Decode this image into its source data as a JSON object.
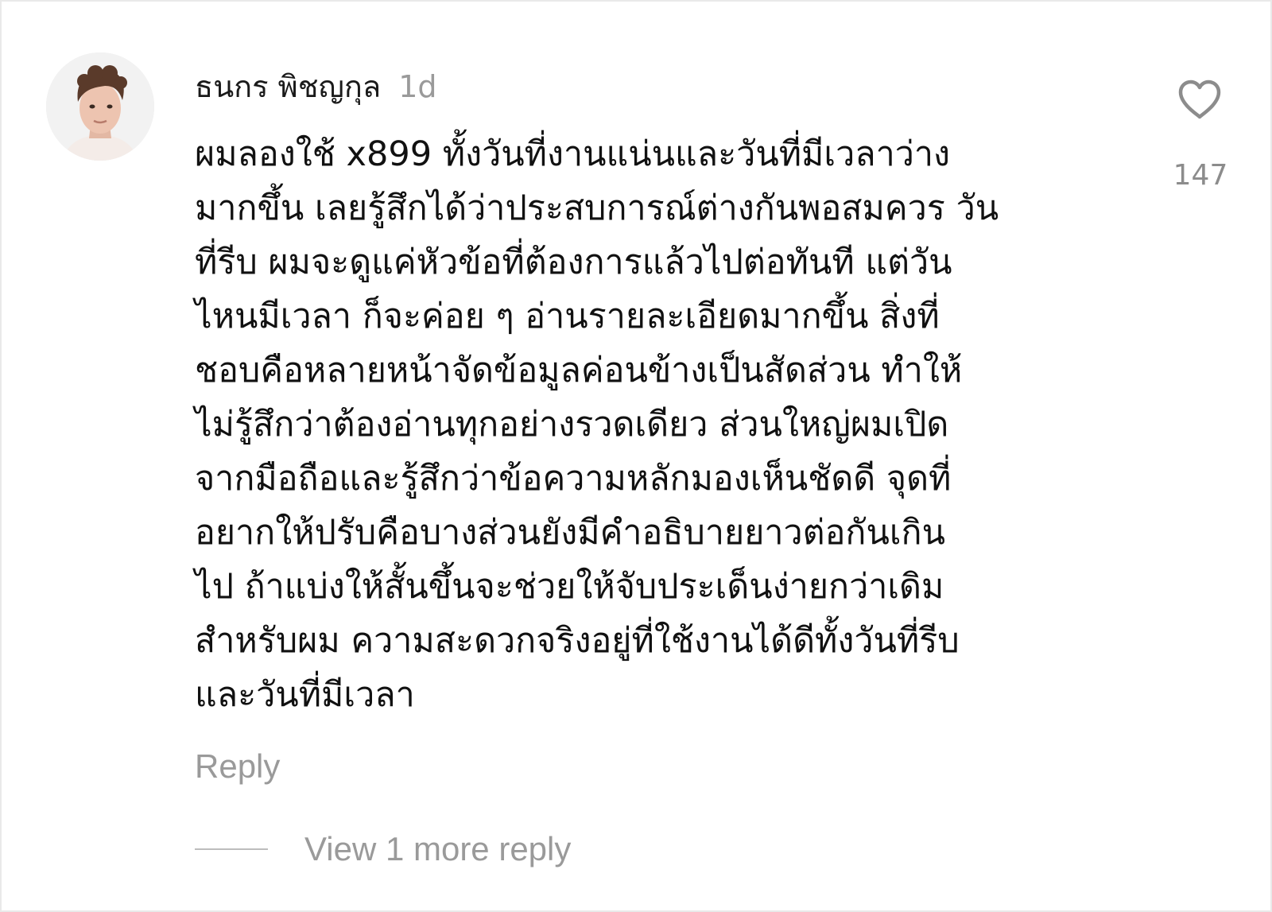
{
  "comment": {
    "avatar_icon": "user-portrait-photo",
    "username": "ธนกร พิชญกุล",
    "timestamp": "1d",
    "body_lines": [
      "ผมลองใช้ x899 ทั้งวันที่งานแน่นและวันที่มีเวลาว่าง",
      "มากขึ้น เลยรู้สึกได้ว่าประสบการณ์ต่างกันพอสมควร วัน",
      "ที่รีบ ผมจะดูแค่หัวข้อที่ต้องการแล้วไปต่อทันที แต่วัน",
      "ไหนมีเวลา ก็จะค่อย ๆ อ่านรายละเอียดมากขึ้น สิ่งที่",
      "ชอบคือหลายหน้าจัดข้อมูลค่อนข้างเป็นสัดส่วน ทำให้",
      "ไม่รู้สึกว่าต้องอ่านทุกอย่างรวดเดียว ส่วนใหญ่ผมเปิด",
      "จากมือถือและรู้สึกว่าข้อความหลักมองเห็นชัดดี จุดที่",
      "อยากให้ปรับคือบางส่วนยังมีคำอธิบายยาวต่อกันเกิน",
      "ไป ถ้าแบ่งให้สั้นขึ้นจะช่วยให้จับประเด็นง่ายกว่าเดิม",
      "สำหรับผม ความสะดวกจริงอยู่ที่ใช้งานได้ดีทั้งวันที่รีบ",
      "และวันที่มีเวลา"
    ],
    "like_icon": "heart-outline-icon",
    "like_count": "147",
    "reply_label": "Reply",
    "view_replies_label": "View 1 more reply"
  },
  "colors": {
    "text_primary": "#111111",
    "text_secondary": "#9a9a9a",
    "background": "#ffffff"
  }
}
